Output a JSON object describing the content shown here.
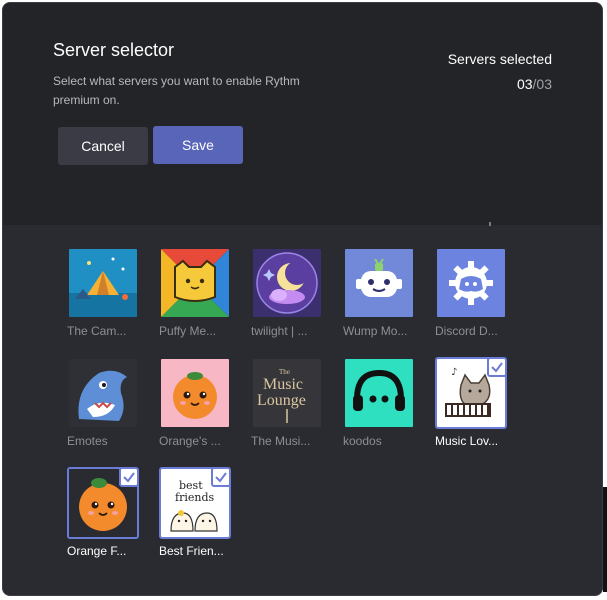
{
  "modal": {
    "title": "Server selector",
    "description": "Select what servers you want to enable Rythm premium on.",
    "selected_label": "Servers selected",
    "selected_count": "03",
    "selected_total": "/03",
    "cancel_label": "Cancel",
    "save_label": "Save"
  },
  "colors": {
    "accent": "#5865b8",
    "selected_border": "#6b7cd6",
    "background": "#2a2b31",
    "header": "#232428"
  },
  "servers": [
    {
      "name": "The Cam...",
      "icon": "camping-tent-icon",
      "selected": false
    },
    {
      "name": "Puffy Me...",
      "icon": "yellow-cat-icon",
      "selected": false
    },
    {
      "name": "twilight | ...",
      "icon": "moon-cloud-icon",
      "selected": false
    },
    {
      "name": "Wump Mo...",
      "icon": "wumpus-robot-icon",
      "selected": false
    },
    {
      "name": "Discord D...",
      "icon": "discord-logo-icon",
      "selected": false
    },
    {
      "name": "Emotes",
      "icon": "shark-icon",
      "selected": false
    },
    {
      "name": "Orange's ...",
      "icon": "orange-face-icon",
      "selected": false
    },
    {
      "name": "The Musi...",
      "icon": "music-lounge-logo",
      "selected": false
    },
    {
      "name": "koodos",
      "icon": "headphones-icon",
      "selected": false
    },
    {
      "name": "Music Lov...",
      "icon": "piano-cat-icon",
      "selected": true
    },
    {
      "name": "Orange F...",
      "icon": "orange-face-icon",
      "selected": true
    },
    {
      "name": "Best Frien...",
      "icon": "best-friends-icon",
      "selected": true
    }
  ],
  "icon_text": {
    "music_lounge_1": "The",
    "music_lounge_2": "Music",
    "music_lounge_3": "Lounge",
    "best_friends_1": "best",
    "best_friends_2": "friends"
  }
}
